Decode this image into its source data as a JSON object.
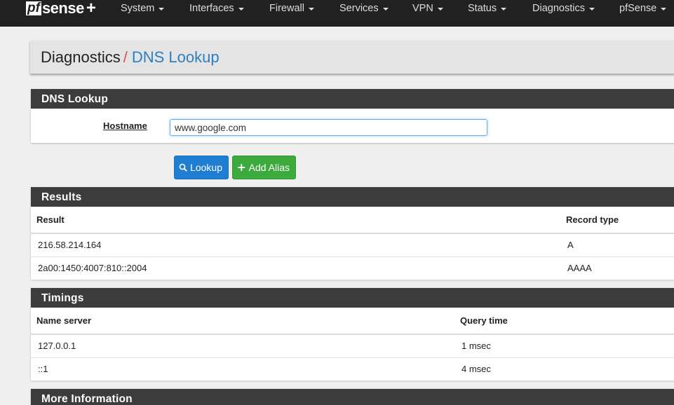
{
  "nav": {
    "logo_pf": "pf",
    "logo_sense": "sense",
    "logo_plus": "+",
    "items": [
      {
        "label": "System"
      },
      {
        "label": "Interfaces"
      },
      {
        "label": "Firewall"
      },
      {
        "label": "Services"
      },
      {
        "label": "VPN"
      },
      {
        "label": "Status"
      },
      {
        "label": "Diagnostics"
      },
      {
        "label": "pfSense"
      }
    ]
  },
  "breadcrumb": {
    "parent": "Diagnostics",
    "separator": "/",
    "current": "DNS Lookup"
  },
  "lookup_panel": {
    "title": "DNS Lookup",
    "hostname_label": "Hostname",
    "hostname_value": "www.google.com"
  },
  "buttons": {
    "lookup": "Lookup",
    "add_alias": "Add Alias"
  },
  "results_panel": {
    "title": "Results",
    "columns": [
      "Result",
      "Record type"
    ],
    "rows": [
      {
        "result": "216.58.214.164",
        "type": "A"
      },
      {
        "result": "2a00:1450:4007:810::2004",
        "type": "AAAA"
      }
    ]
  },
  "timings_panel": {
    "title": "Timings",
    "columns": [
      "Name server",
      "Query time"
    ],
    "rows": [
      {
        "server": "127.0.0.1",
        "time": "1 msec"
      },
      {
        "server": "::1",
        "time": "4 msec"
      }
    ]
  },
  "more_panel": {
    "title": "More Information"
  },
  "colors": {
    "navbar": "#212121",
    "panel_header": "#3c3c3c",
    "link_blue": "#2e7ebf",
    "separator_red": "#d9534f",
    "btn_primary": "#1f7ed1",
    "btn_success": "#3daa3d"
  }
}
